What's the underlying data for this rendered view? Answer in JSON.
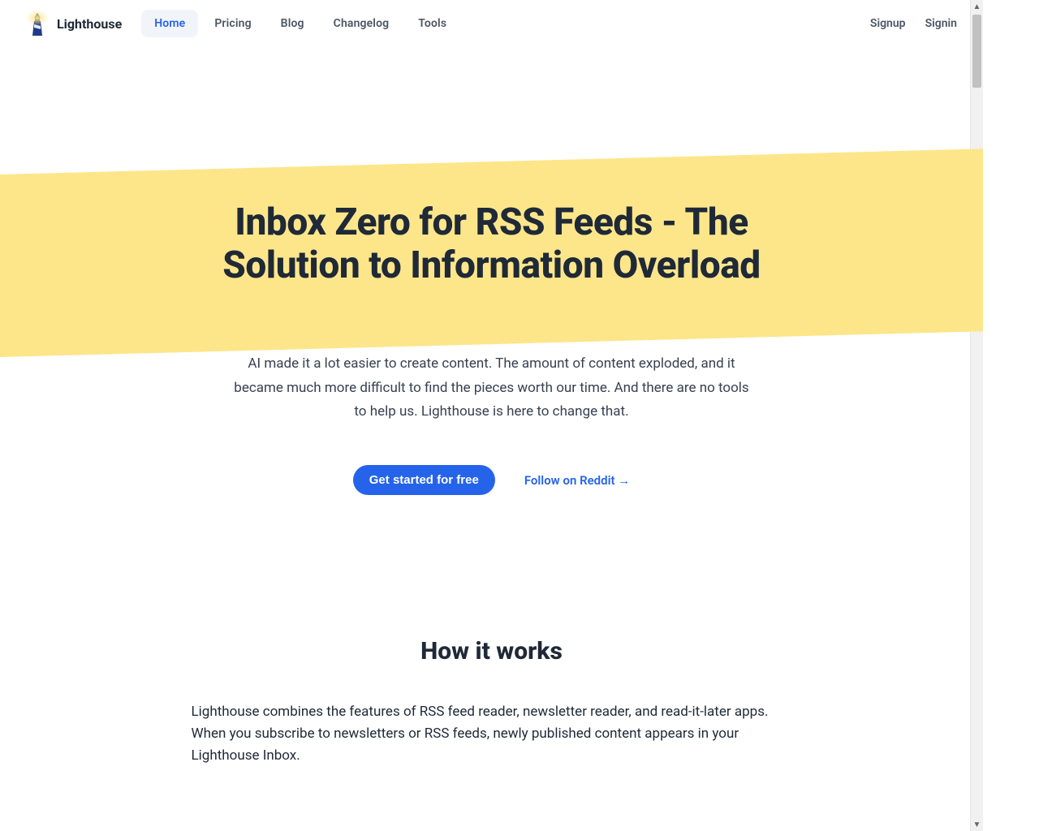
{
  "brand": {
    "name": "Lighthouse"
  },
  "nav": {
    "items": [
      {
        "label": "Home",
        "active": true
      },
      {
        "label": "Pricing",
        "active": false
      },
      {
        "label": "Blog",
        "active": false
      },
      {
        "label": "Changelog",
        "active": false
      },
      {
        "label": "Tools",
        "active": false
      }
    ],
    "signup": "Signup",
    "signin": "Signin"
  },
  "hero": {
    "title": "Inbox Zero for RSS Feeds - The Solution to Information Overload",
    "subtitle": "AI made it a lot easier to create content. The amount of content exploded, and it became much more difficult to find the pieces worth our time. And there are no tools to help us. Lighthouse is here to change that.",
    "cta_primary": "Get started for free",
    "cta_secondary": "Follow on Reddit →"
  },
  "how": {
    "title": "How it works",
    "body": "Lighthouse combines the features of RSS feed reader, newsletter reader, and read-it-later apps. When you subscribe to newsletters or RSS feeds, newly published content appears in your Lighthouse Inbox."
  },
  "colors": {
    "accent_yellow": "#fde68a",
    "primary_blue": "#2563eb",
    "text_dark": "#1f2937"
  }
}
